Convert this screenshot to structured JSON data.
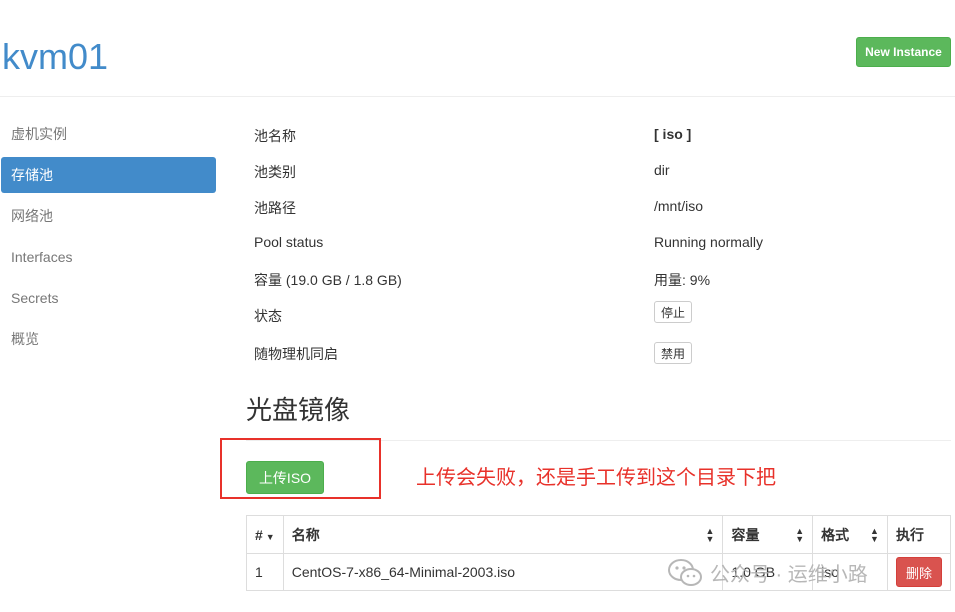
{
  "header": {
    "title": "kvm01",
    "new_instance_label": "New Instance"
  },
  "sidebar": {
    "items": [
      {
        "label": "虚机实例",
        "active": false
      },
      {
        "label": "存储池",
        "active": true
      },
      {
        "label": "网络池",
        "active": false
      },
      {
        "label": "Interfaces",
        "active": false
      },
      {
        "label": "Secrets",
        "active": false
      },
      {
        "label": "概览",
        "active": false
      }
    ]
  },
  "pool": {
    "name_label": "池名称",
    "name_value": "[ iso ]",
    "type_label": "池类别",
    "type_value": "dir",
    "path_label": "池路径",
    "path_value": "/mnt/iso",
    "status_label": "Pool status",
    "status_value": "Running normally",
    "capacity_label": "容量 (19.0 GB / 1.8 GB)",
    "usage_value": "用量: 9%",
    "state_label": "状态",
    "stop_button": "停止",
    "autostart_label": "随物理机同启",
    "disable_button": "禁用"
  },
  "iso_section": {
    "title": "光盘镜像",
    "upload_button": "上传ISO",
    "annotation": "上传会失败，还是手工传到这个目录下把"
  },
  "table": {
    "headers": [
      "#",
      "名称",
      "容量",
      "格式",
      "执行"
    ],
    "rows": [
      {
        "index": "1",
        "name": "CentOS-7-x86_64-Minimal-2003.iso",
        "size": "1.0 GB",
        "format": "iso",
        "action": "删除"
      }
    ]
  },
  "watermark": {
    "text": "公众号 · 运维小路",
    "icon": "wechat-icon"
  },
  "colors": {
    "primary": "#428bca",
    "success": "#5cb85c",
    "danger": "#d9534f",
    "annotation": "#e8312a"
  }
}
